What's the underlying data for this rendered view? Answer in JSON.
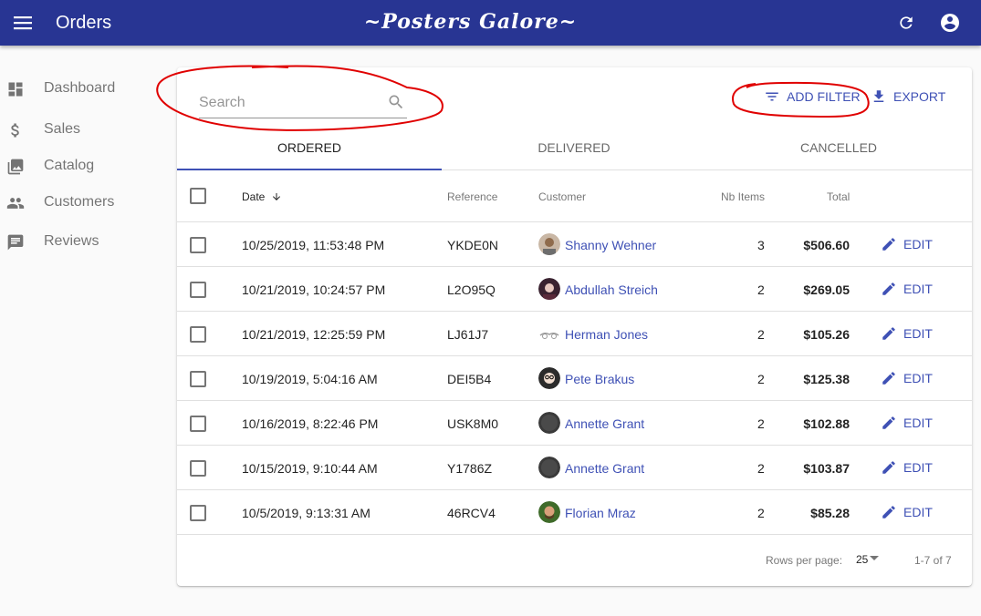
{
  "appbar": {
    "title": "Orders",
    "brand": "~Posters Galore~",
    "bg": "#283593"
  },
  "sidebar": {
    "items": [
      {
        "label": "Dashboard",
        "icon": "dashboard-icon"
      },
      {
        "label": "Sales",
        "icon": "dollar-icon"
      },
      {
        "label": "Catalog",
        "icon": "photo-library-icon"
      },
      {
        "label": "Customers",
        "icon": "people-icon"
      },
      {
        "label": "Reviews",
        "icon": "comment-icon"
      }
    ]
  },
  "search": {
    "placeholder": "Search"
  },
  "toolbar": {
    "add_filter": "ADD FILTER",
    "export": "EXPORT"
  },
  "tabs": [
    {
      "label": "ORDERED",
      "active": true
    },
    {
      "label": "DELIVERED"
    },
    {
      "label": "CANCELLED"
    }
  ],
  "table": {
    "headers": {
      "date": "Date",
      "reference": "Reference",
      "customer": "Customer",
      "items": "Nb Items",
      "total": "Total"
    },
    "rows": [
      {
        "date": "10/25/2019, 11:53:48 PM",
        "reference": "YKDE0N",
        "customer": "Shanny Wehner",
        "items": "3",
        "total": "$506.60",
        "action": "EDIT"
      },
      {
        "date": "10/21/2019, 10:24:57 PM",
        "reference": "L2O95Q",
        "customer": "Abdullah Streich",
        "items": "2",
        "total": "$269.05",
        "action": "EDIT"
      },
      {
        "date": "10/21/2019, 12:25:59 PM",
        "reference": "LJ61J7",
        "customer": "Herman Jones",
        "items": "2",
        "total": "$105.26",
        "action": "EDIT"
      },
      {
        "date": "10/19/2019, 5:04:16 AM",
        "reference": "DEI5B4",
        "customer": "Pete Brakus",
        "items": "2",
        "total": "$125.38",
        "action": "EDIT"
      },
      {
        "date": "10/16/2019, 8:22:46 PM",
        "reference": "USK8M0",
        "customer": "Annette Grant",
        "items": "2",
        "total": "$102.88",
        "action": "EDIT"
      },
      {
        "date": "10/15/2019, 9:10:44 AM",
        "reference": "Y1786Z",
        "customer": "Annette Grant",
        "items": "2",
        "total": "$103.87",
        "action": "EDIT"
      },
      {
        "date": "10/5/2019, 9:13:31 AM",
        "reference": "46RCV4",
        "customer": "Florian Mraz",
        "items": "2",
        "total": "$85.28",
        "action": "EDIT"
      }
    ]
  },
  "pagination": {
    "rows_per_page_label": "Rows per page:",
    "rows_per_page": "25",
    "range": "1-7 of 7"
  },
  "colors": {
    "accent": "#3f51b5",
    "annotation": "#e00000"
  }
}
